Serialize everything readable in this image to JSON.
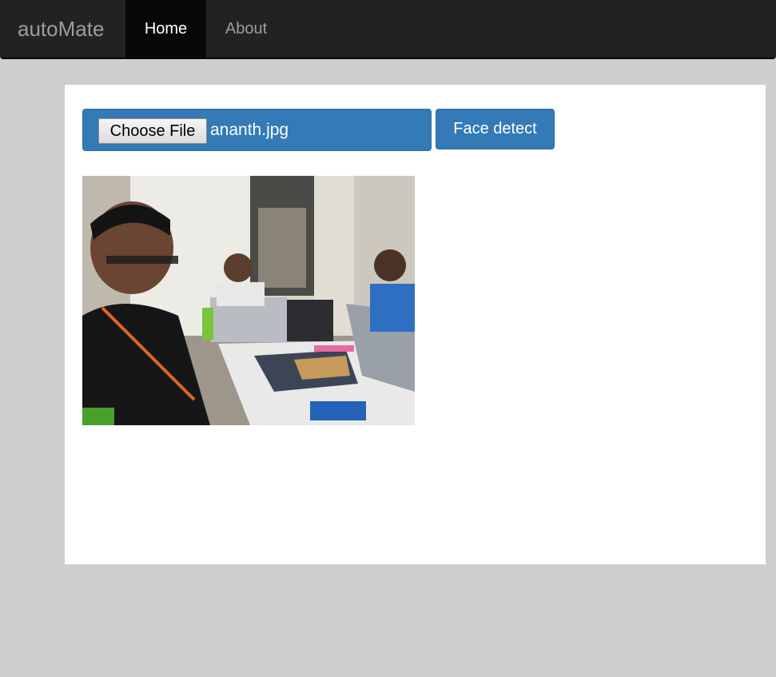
{
  "navbar": {
    "brand": "autoMate",
    "items": [
      {
        "label": "Home",
        "active": true
      },
      {
        "label": "About",
        "active": false
      }
    ]
  },
  "upload": {
    "choose_label": "Choose File",
    "file_name": "ananth.jpg",
    "detect_label": "Face detect"
  },
  "colors": {
    "navbar_bg": "#222222",
    "active_nav_bg": "#080808",
    "primary_button": "#337ab7",
    "page_bg": "#cecece"
  }
}
